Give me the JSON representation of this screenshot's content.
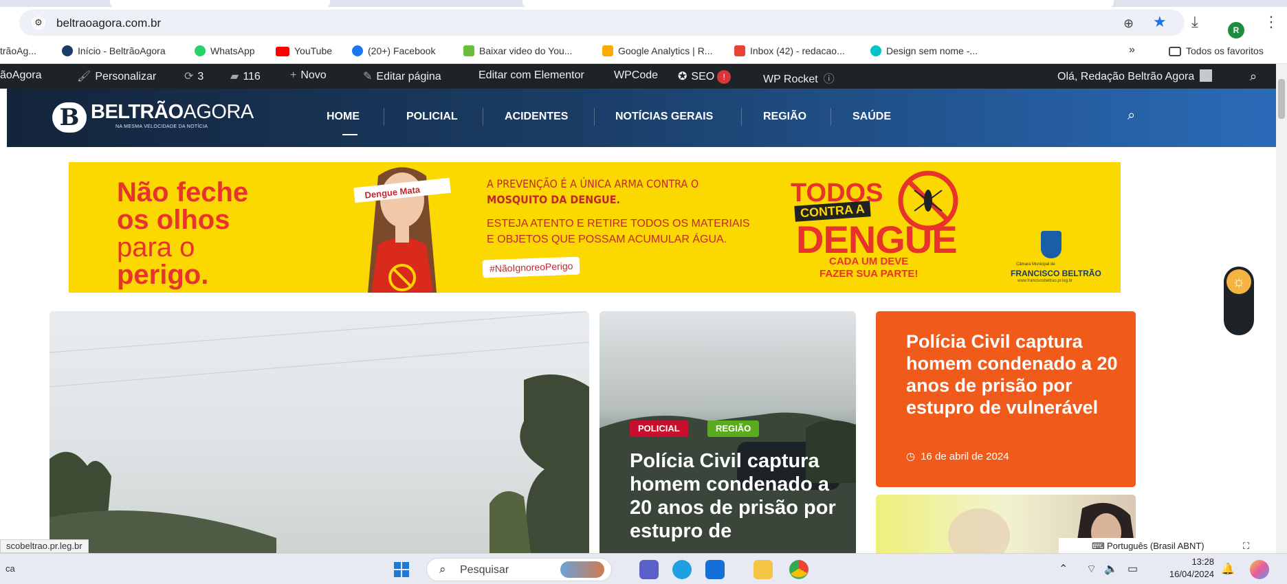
{
  "browser": {
    "url": "beltraoagora.com.br",
    "profile_initial": "R",
    "bookmarks": [
      {
        "label": "trãoAg...",
        "color": "#1a3d66"
      },
      {
        "label": "Início - BeltrãoAgora",
        "color": "#1a3d66"
      },
      {
        "label": "WhatsApp",
        "color": "#25d366"
      },
      {
        "label": "YouTube",
        "color": "#ff0000"
      },
      {
        "label": "(20+) Facebook",
        "color": "#1877f2"
      },
      {
        "label": "Baixar video do You...",
        "color": "#6abf3a"
      },
      {
        "label": "Google Analytics | R...",
        "color": "#f9ab00"
      },
      {
        "label": "Inbox (42) - redacao...",
        "color": "#ea4335"
      },
      {
        "label": "Design sem nome -...",
        "color": "#00c4cc"
      }
    ],
    "overflow": "»",
    "all_bookmarks": "Todos os favoritos"
  },
  "adminbar": {
    "site": "ãoAgora",
    "customize": "Personalizar",
    "updates": "3",
    "comments": "116",
    "new": "Novo",
    "edit_page": "Editar página",
    "elementor": "Editar com Elementor",
    "wpcode": "WPCode",
    "seo": "SEO",
    "seo_badge": "!",
    "rocket": "WP Rocket",
    "greeting": "Olá, Redação Beltrão Agora"
  },
  "site": {
    "logo_bold": "BELTRÃO",
    "logo_light": "AGORA",
    "logo_tagline": "NA MESMA VELOCIDADE DA NOTÍCIA",
    "nav": [
      "HOME",
      "POLICIAL",
      "ACIDENTES",
      "NOTÍCIAS GERAIS",
      "REGIÃO",
      "SAÚDE"
    ]
  },
  "ad": {
    "headline_1": "Não feche",
    "headline_2": "os olhos",
    "headline_3": "para o",
    "headline_4": "perigo.",
    "blindfold": "Dengue Mata",
    "msg_line1": "A PREVENÇÃO É A ÚNICA ARMA CONTRA O",
    "msg_line2": "MOSQUITO DA DENGUE.",
    "msg_body": "ESTEJA ATENTO E RETIRE TODOS OS MATERIAIS E OBJETOS QUE POSSAM ACUMULAR ÁGUA.",
    "hashtag": "#NãoIgnoreoPerigo",
    "todos": "TODOS",
    "contra": "CONTRA A",
    "dengue": "DENGUE",
    "cada": "CADA UM DEVE",
    "fazer": "FAZER SUA PARTE!",
    "chamber_small": "Câmara Municipal de",
    "chamber_name": "FRANCISCO BELTRÃO",
    "chamber_url": "www.franciscobeltrao.pr.leg.br"
  },
  "cards": {
    "mid_tags": [
      "POLICIAL",
      "REGIÃO"
    ],
    "mid_title": "Polícia Civil captura homem condenado a 20 anos de prisão por estupro de",
    "orange_title": "Polícia Civil captura homem condenado a 20 anos de prisão por estupro de vulnerável",
    "orange_date": "16 de abril de 2024"
  },
  "statusbar": {
    "url": "scobeltrao.pr.leg.br",
    "language": "Português (Brasil ABNT)"
  },
  "taskbar": {
    "left_text": "ca",
    "search_placeholder": "Pesquisar",
    "time": "13:28",
    "date": "16/04/2024"
  },
  "colors": {
    "accent_orange": "#f05a1a",
    "tag_policial": "#c8102e",
    "tag_regiao": "#5aac1e",
    "ad_yellow": "#fbd800",
    "ad_red": "#e8322c"
  }
}
